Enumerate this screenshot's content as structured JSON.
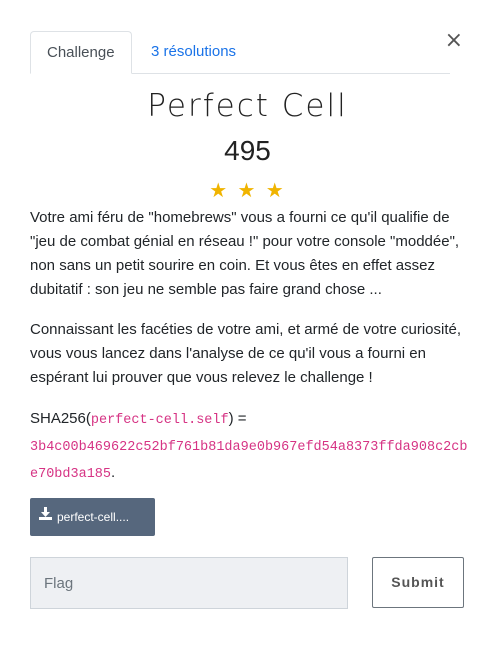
{
  "modal": {
    "close_icon": "×"
  },
  "tabs": [
    {
      "label": "Challenge",
      "active": true
    },
    {
      "label": "3 résolutions",
      "active": false
    }
  ],
  "challenge": {
    "title": "Perfect Cell",
    "points": "495",
    "stars": "★ ★ ★",
    "description": [
      "Votre ami féru de \"homebrews\" vous a fourni ce qu'il qualifie de \"jeu de combat génial en réseau !\" pour votre console \"moddée\", non sans un petit sourire en coin. Et vous êtes en effet assez dubitatif : son jeu ne semble pas faire grand chose ...",
      "Connaissant les facéties de votre ami, et armé de votre curiosité, vous vous lancez dans l'analyse de ce qu'il vous a fourni en espérant lui prouver que vous relevez le challenge !"
    ],
    "sha_prefix": "SHA256(",
    "sha_file": "perfect-cell.self",
    "sha_suffix": ") =",
    "sha_hash": "3b4c00b469622c52bf761b81da9e0b967efd54a8373ffda908c2cbe70bd3a185",
    "sha_end": "."
  },
  "download": {
    "label": "perfect-cell....",
    "icon": "download-icon"
  },
  "flag": {
    "placeholder": "Flag",
    "value": ""
  },
  "submit": {
    "label": "Submit"
  },
  "colors": {
    "link": "#1a73e8",
    "star": "#f0b400",
    "code": "#d63384",
    "download_bg": "#56677d"
  }
}
